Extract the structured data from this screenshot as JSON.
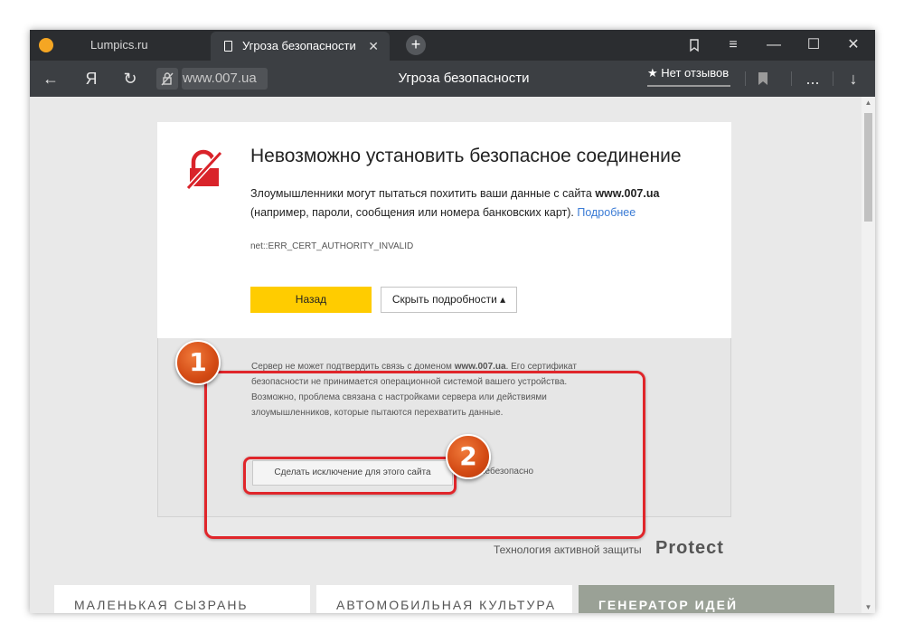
{
  "browser": {
    "tabs": [
      {
        "label": "Lumpics.ru",
        "active": false
      },
      {
        "label": "Угроза безопасности",
        "active": true
      }
    ],
    "new_tab_label": "+",
    "close_tab_glyph": "✕",
    "window_buttons": {
      "menu": "≡",
      "minimize": "—",
      "maximize": "☐",
      "close": "✕"
    },
    "toolbar": {
      "back_glyph": "←",
      "yandex_glyph": "Я",
      "refresh_glyph": "↻",
      "url": "www.007.ua",
      "page_title": "Угроза безопасности",
      "reviews": "★ Нет отзывов",
      "more_glyph": "...",
      "download_glyph": "↓"
    }
  },
  "error_page": {
    "heading": "Невозможно установить безопасное соединение",
    "desc_before": "Злоумышленники могут пытаться похитить ваши данные с сайта ",
    "desc_domain": "www.007.ua",
    "desc_after": " (например, пароли, сообщения или номера банковских карт). ",
    "more_link": "Подробнее",
    "error_code": "net::ERR_CERT_AUTHORITY_INVALID",
    "back_button": "Назад",
    "hide_details_button": "Скрыть подробности ▴",
    "details_before": "Сервер не может подтвердить связь с доменом ",
    "details_domain": "www.007.ua",
    "details_after": ". Его сертификат безопасности не принимается операционной системой вашего устройства. Возможно, проблема связана с настройками сервера или действиями злоумышленников, которые пытаются перехватить данные.",
    "exception_button": "Сделать исключение для этого сайта",
    "unsafe_text": "небезопасно"
  },
  "annotations": {
    "badge1": "1",
    "badge2": "2",
    "color": "#e0262b"
  },
  "protect": {
    "caption": "Технология активной защиты",
    "word": "Protect"
  },
  "tiles": [
    "МАЛЕНЬКАЯ СЫЗРАНЬ",
    "АВТОМОБИЛЬНАЯ КУЛЬТУРА ...",
    "ГЕНЕРАТОР ИДЕЙ"
  ],
  "scrollbar": {
    "up": "▲",
    "down": "▼"
  },
  "colors": {
    "accent": "#ffcc00",
    "link": "#3a7bd5",
    "error_icon": "#d9232a"
  },
  "icons": [
    "browser-logo-icon",
    "document-icon",
    "bookmarks-icon",
    "no-https-icon",
    "bookmark-icon",
    "broken-lock-icon"
  ]
}
